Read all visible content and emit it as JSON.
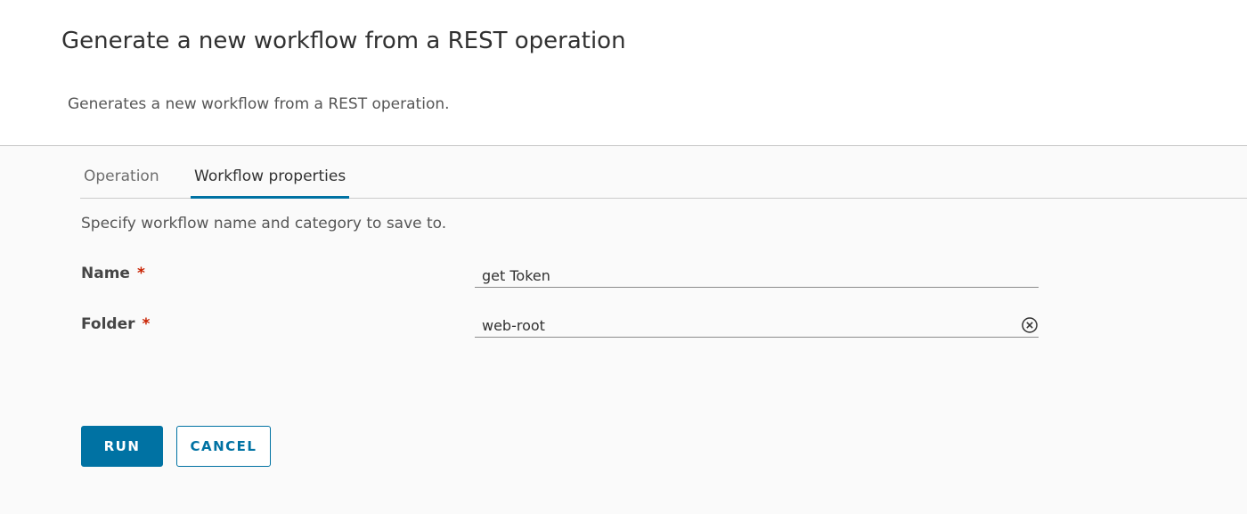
{
  "header": {
    "title": "Generate a new workflow from a REST operation",
    "subtitle": "Generates a new workflow from a REST operation."
  },
  "tabs": [
    {
      "label": "Operation",
      "active": false
    },
    {
      "label": "Workflow properties",
      "active": true
    }
  ],
  "form": {
    "instructions": "Specify workflow name and category to save to.",
    "required_marker": "*",
    "fields": {
      "name": {
        "label": "Name",
        "value": "get Token"
      },
      "folder": {
        "label": "Folder",
        "value": "web-root",
        "clear_icon": "clear-circle-icon"
      }
    }
  },
  "actions": {
    "run_label": "RUN",
    "cancel_label": "CANCEL"
  },
  "colors": {
    "accent": "#0072a3",
    "required": "#c92100",
    "panel_background": "#fafafa"
  }
}
